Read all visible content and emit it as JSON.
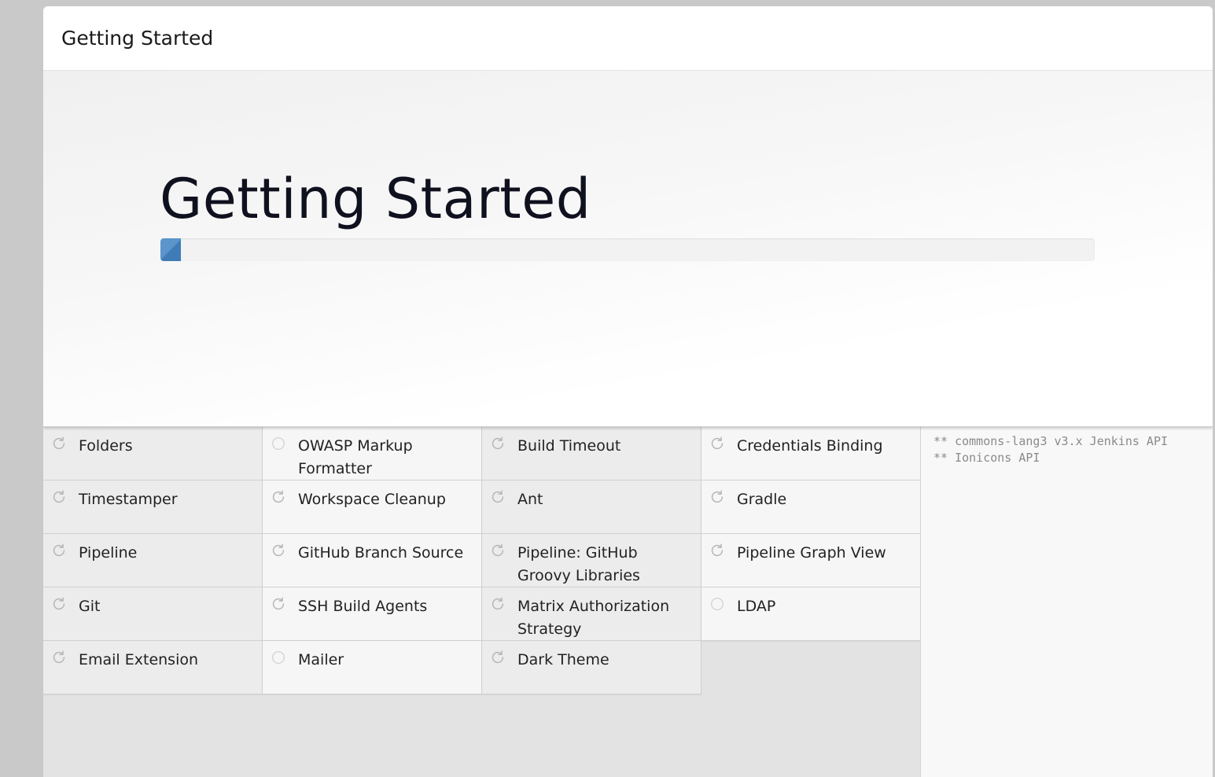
{
  "header": {
    "title": "Getting Started"
  },
  "hero": {
    "title": "Getting Started",
    "progress": 0.022
  },
  "plugins": [
    {
      "name": "Folders",
      "state": "installing"
    },
    {
      "name": "OWASP Markup Formatter",
      "state": "pending"
    },
    {
      "name": "Build Timeout",
      "state": "installing"
    },
    {
      "name": "Credentials Binding",
      "state": "installing"
    },
    {
      "name": "Timestamper",
      "state": "installing"
    },
    {
      "name": "Workspace Cleanup",
      "state": "installing"
    },
    {
      "name": "Ant",
      "state": "installing"
    },
    {
      "name": "Gradle",
      "state": "installing"
    },
    {
      "name": "Pipeline",
      "state": "installing"
    },
    {
      "name": "GitHub Branch Source",
      "state": "installing"
    },
    {
      "name": "Pipeline: GitHub Groovy Libraries",
      "state": "installing"
    },
    {
      "name": "Pipeline Graph View",
      "state": "installing"
    },
    {
      "name": "Git",
      "state": "installing"
    },
    {
      "name": "SSH Build Agents",
      "state": "installing"
    },
    {
      "name": "Matrix Authorization Strategy",
      "state": "installing"
    },
    {
      "name": "LDAP",
      "state": "pending"
    },
    {
      "name": "Email Extension",
      "state": "installing"
    },
    {
      "name": "Mailer",
      "state": "pending"
    },
    {
      "name": "Dark Theme",
      "state": "installing"
    }
  ],
  "log": {
    "lines": [
      "** commons-lang3 v3.x Jenkins API",
      "** Ionicons API"
    ]
  },
  "icons": {
    "installing": "refresh-icon",
    "pending": "circle-icon"
  },
  "colors": {
    "progress": "#4a87c2",
    "icon": "#b5b5b5"
  }
}
